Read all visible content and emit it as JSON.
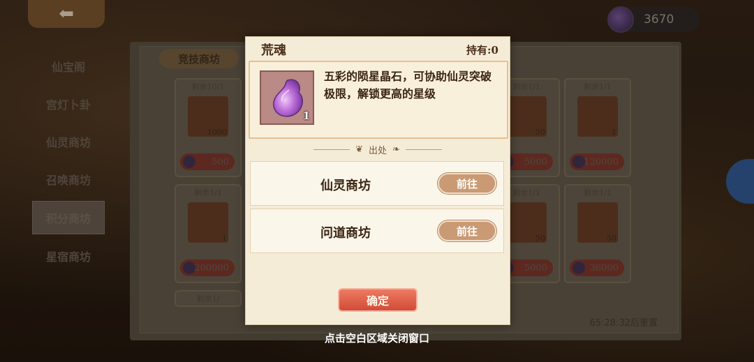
{
  "background": {
    "currency": {
      "amount": "3670",
      "icon": "purple-gem-icon"
    },
    "sidebar": [
      "仙宝阁",
      "宫灯卜卦",
      "仙灵商坊",
      "召唤商坊",
      "积分商坊",
      "星宿商坊"
    ],
    "active_sidebar": "积分商坊",
    "shop_tab": "竞技商坊",
    "cards": [
      {
        "stock": "剩余10/1",
        "qty": "1000",
        "price": "500"
      },
      {
        "stock": "剩余1/1",
        "qty": "50",
        "price": "5000"
      },
      {
        "stock": "剩余1/1",
        "qty": "1",
        "price": "120000"
      },
      {
        "stock": "剩余1/1",
        "qty": "1",
        "price": "200000"
      },
      {
        "stock": "剩余1/1",
        "qty": "50",
        "price": "5000"
      },
      {
        "stock": "剩余1/1",
        "qty": "50",
        "price": "36000"
      }
    ],
    "partial_stock": "剩余1/",
    "reset_time": "65:28:32后重置"
  },
  "modal": {
    "title": "荒魂",
    "owned": "持有:0",
    "item_count": "1",
    "description": "五彩的陨星晶石，可协助仙灵突破极限，解锁更高的星级",
    "source_label": "出处",
    "sources": [
      {
        "name": "仙灵商坊",
        "button": "前往"
      },
      {
        "name": "问道商坊",
        "button": "前往"
      }
    ],
    "confirm": "确定"
  },
  "close_hint": "点击空白区域关闭窗口"
}
